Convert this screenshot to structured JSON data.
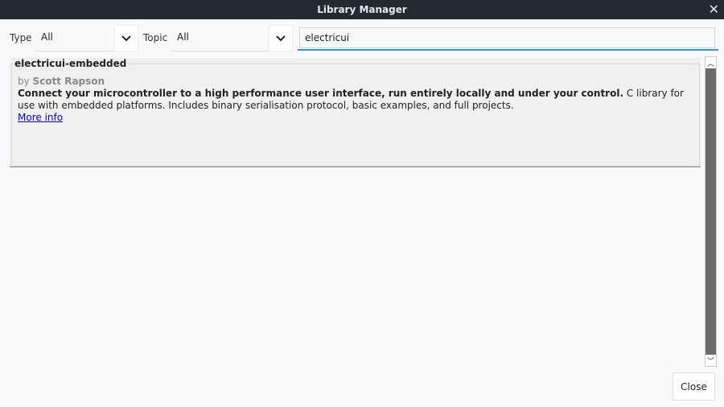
{
  "window": {
    "title": "Library Manager",
    "close_icon": "close-icon"
  },
  "filters": {
    "type_label": "Type",
    "type_value": "All",
    "topic_label": "Topic",
    "topic_value": "All"
  },
  "search": {
    "value": "electricui",
    "placeholder": ""
  },
  "colors": {
    "accent": "#3d8ee8",
    "titlebar": "#232a2f",
    "card": "#eef1f0"
  },
  "libraries": [
    {
      "name": "electricui-embedded",
      "by_prefix": "by",
      "author": "Scott Rapson",
      "sentence": "Connect your microcontroller to a high performance user interface, run entirely locally and under your control.",
      "paragraph": " C library for use with embedded platforms. Includes binary serialisation protocol, basic examples, and full projects.",
      "more_info": "More info"
    }
  ],
  "footer": {
    "close_label": "Close"
  }
}
